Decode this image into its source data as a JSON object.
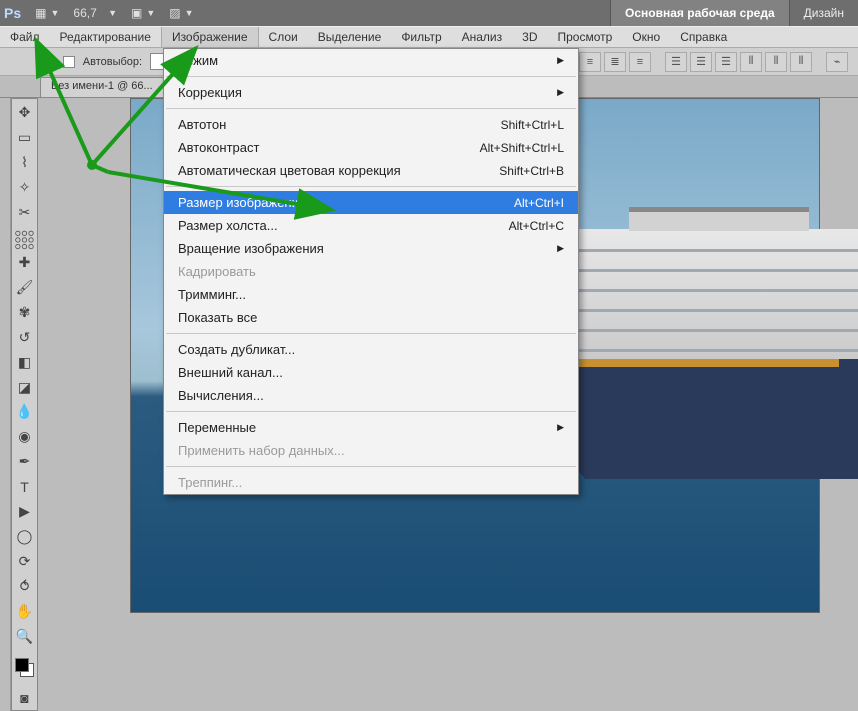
{
  "topbar": {
    "logo": "Ps",
    "zoom": "66,7",
    "workspace_active": "Основная рабочая среда",
    "workspace_other": "Дизайн"
  },
  "menubar": {
    "items": [
      "Файл",
      "Редактирование",
      "Изображение",
      "Слои",
      "Выделение",
      "Фильтр",
      "Анализ",
      "3D",
      "Просмотр",
      "Окно",
      "Справка"
    ],
    "open_index": 2
  },
  "optionsbar": {
    "autoselect_label": "Автовыбор:"
  },
  "doctab": {
    "title": "Без имени-1 @ 66..."
  },
  "dropdown": {
    "rows": [
      {
        "type": "item",
        "label": "Режим",
        "submenu": true
      },
      {
        "type": "sep"
      },
      {
        "type": "item",
        "label": "Коррекция",
        "submenu": true
      },
      {
        "type": "sep"
      },
      {
        "type": "item",
        "label": "Автотон",
        "shortcut": "Shift+Ctrl+L"
      },
      {
        "type": "item",
        "label": "Автоконтраст",
        "shortcut": "Alt+Shift+Ctrl+L"
      },
      {
        "type": "item",
        "label": "Автоматическая цветовая коррекция",
        "shortcut": "Shift+Ctrl+B"
      },
      {
        "type": "sep"
      },
      {
        "type": "item",
        "label": "Размер изображения...",
        "shortcut": "Alt+Ctrl+I",
        "highlight": true
      },
      {
        "type": "item",
        "label": "Размер холста...",
        "shortcut": "Alt+Ctrl+C"
      },
      {
        "type": "item",
        "label": "Вращение изображения",
        "submenu": true
      },
      {
        "type": "item",
        "label": "Кадрировать",
        "disabled": true
      },
      {
        "type": "item",
        "label": "Тримминг..."
      },
      {
        "type": "item",
        "label": "Показать все"
      },
      {
        "type": "sep"
      },
      {
        "type": "item",
        "label": "Создать дубликат..."
      },
      {
        "type": "item",
        "label": "Внешний канал..."
      },
      {
        "type": "item",
        "label": "Вычисления..."
      },
      {
        "type": "sep"
      },
      {
        "type": "item",
        "label": "Переменные",
        "submenu": true
      },
      {
        "type": "item",
        "label": "Применить набор данных...",
        "disabled": true
      },
      {
        "type": "sep"
      },
      {
        "type": "item",
        "label": "Треппинг...",
        "disabled": true
      }
    ]
  },
  "tools": [
    "move",
    "marquee",
    "lasso",
    "wand",
    "crop",
    "eyedropper",
    "healing",
    "brush",
    "stamp",
    "history-brush",
    "eraser",
    "gradient",
    "blur",
    "dodge",
    "pen",
    "type",
    "path-select",
    "shape",
    "3d-rotate",
    "3d-orbit",
    "hand",
    "zoom"
  ]
}
